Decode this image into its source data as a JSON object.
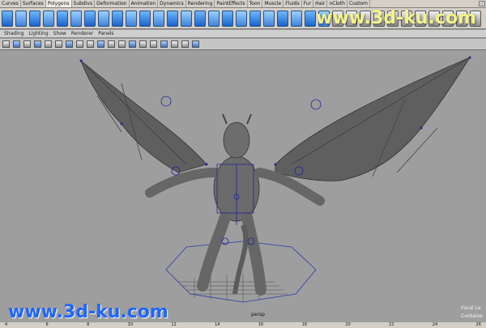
{
  "tabs": [
    "Curves",
    "Surfaces",
    "Polygons",
    "Subdivs",
    "Deformation",
    "Animation",
    "Dynamics",
    "Rendering",
    "PaintEffects",
    "Toon",
    "Muscle",
    "Fluids",
    "Fur",
    "Hair",
    "nCloth",
    "Custom"
  ],
  "active_tab": "Polygons",
  "panel_menu": [
    "Shading",
    "Lighting",
    "Show",
    "Renderer",
    "Panels"
  ],
  "viewport": {
    "camera_label": "persp",
    "focal_label": "Focal Le",
    "container_label": "Containe"
  },
  "watermarks": {
    "top": "www.3d-ku.com",
    "bottom": "www.3d-ku.com"
  },
  "timeline_ticks": [
    "4",
    "6",
    "8",
    "10",
    "12",
    "14",
    "16",
    "18",
    "20",
    "22",
    "24",
    "26"
  ],
  "colors": {
    "accent_blue": "#1f66ff",
    "watermark_top": "#f3f38b",
    "viewport_bg": "#9e9e9e"
  }
}
